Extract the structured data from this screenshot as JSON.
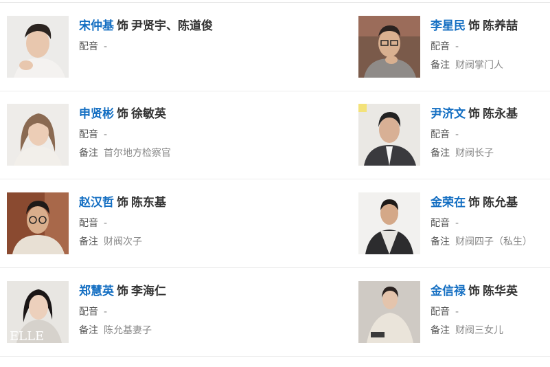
{
  "cast": [
    {
      "actor": "宋仲基",
      "shi": "饰",
      "role": "尹贤宇、陈道俊",
      "dub_label": "配音",
      "dub": "-",
      "note_label": "",
      "note": ""
    },
    {
      "actor": "李星民",
      "shi": "饰",
      "role": "陈养喆",
      "dub_label": "配音",
      "dub": "-",
      "note_label": "备注",
      "note": "财阀掌门人"
    },
    {
      "actor": "申贤彬",
      "shi": "饰",
      "role": "徐敏英",
      "dub_label": "配音",
      "dub": "-",
      "note_label": "备注",
      "note": "首尔地方检察官"
    },
    {
      "actor": "尹济文",
      "shi": "饰",
      "role": "陈永基",
      "dub_label": "配音",
      "dub": "-",
      "note_label": "备注",
      "note": "财阀长子"
    },
    {
      "actor": "赵汉哲",
      "shi": "饰",
      "role": "陈东基",
      "dub_label": "配音",
      "dub": "-",
      "note_label": "备注",
      "note": "财阀次子"
    },
    {
      "actor": "金荣在",
      "shi": "饰",
      "role": "陈允基",
      "dub_label": "配音",
      "dub": "-",
      "note_label": "备注",
      "note": "财阀四子（私生）"
    },
    {
      "actor": "郑慧英",
      "shi": "饰",
      "role": "李海仁",
      "dub_label": "配音",
      "dub": "-",
      "note_label": "备注",
      "note": "陈允基妻子"
    },
    {
      "actor": "金信禄",
      "shi": "饰",
      "role": "陈华英",
      "dub_label": "配音",
      "dub": "-",
      "note_label": "备注",
      "note": "财阀三女儿"
    }
  ],
  "photo_watermark": "ELLE",
  "colors": {
    "actor_link": "#136ec2",
    "role_text": "#333333",
    "meta_label": "#555555",
    "meta_value": "#888888",
    "divider": "#ececec"
  }
}
